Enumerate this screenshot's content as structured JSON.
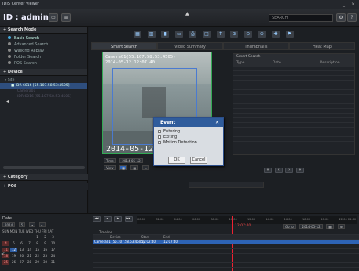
{
  "app": {
    "title": "IDIS Center Viewer"
  },
  "topbar": {
    "user_label": "ID : admin",
    "search_placeholder": "SEARCH"
  },
  "sidebar": {
    "search_mode_title": "+ Search Mode",
    "modes": [
      {
        "label": "Basic Search",
        "active": true
      },
      {
        "label": "Advanced Search",
        "active": false
      },
      {
        "label": "Walking Replay",
        "active": false
      },
      {
        "label": "Folder Search",
        "active": false
      },
      {
        "label": "POS Search",
        "active": false
      }
    ],
    "device_title": "+ Device",
    "devices": [
      {
        "label": "Site",
        "selected": false
      },
      {
        "label": "IDR-6016 [55.107.58.53:4505]",
        "selected": true
      },
      {
        "label": "Camera01",
        "selected": false
      },
      {
        "label": "IDR-6016 [55.107.58.53:4505]",
        "selected": false
      }
    ],
    "category_title": "+ Category",
    "pos_title": "+ POS"
  },
  "tabs": [
    "Smart Search",
    "Video Summary",
    "Thumbnails",
    "Heat Map"
  ],
  "video": {
    "camera_label": "Camera01(55.107.58.53:4505)",
    "timestamp": "2014-05-12 12:07:40",
    "big_timestamp": "2014-05-12 MO"
  },
  "dialog": {
    "title": "Event",
    "options": [
      "Entering",
      "Exiting",
      "Motion Detection"
    ],
    "ok_label": "OK",
    "cancel_label": "Cancel"
  },
  "results": {
    "title": "Smart Search",
    "columns": [
      "Type",
      "Date",
      "Description"
    ]
  },
  "controls": {
    "time_label": "Time",
    "time_value": "2014-05-12",
    "view_label": "View"
  },
  "calendar": {
    "label": "Date",
    "year": "2014",
    "month": "5",
    "days_header": "SUN MON TUE WED THU FRI SAT",
    "today": "12"
  },
  "timeline": {
    "device_tab": "Timeline",
    "col_device": "Device",
    "col_start": "Start",
    "col_end": "End",
    "goto_label": "Go to",
    "goto_value": "2014-05-12",
    "row_label": "Camera01 [55.107.58.53:4505]",
    "row_start": "12:02:40",
    "row_end": "12:07:40",
    "ruler_marks": [
      "00:00",
      "02:00",
      "04:00",
      "06:00",
      "08:00",
      "10:00",
      "12:00",
      "14:00",
      "16:00",
      "18:00",
      "20:00",
      "22:00",
      "24:00"
    ],
    "cursor_time": "12:07:40"
  },
  "colors": {
    "accent": "#2d63b5",
    "cursor": "#e22233",
    "recording": "#3a5"
  }
}
